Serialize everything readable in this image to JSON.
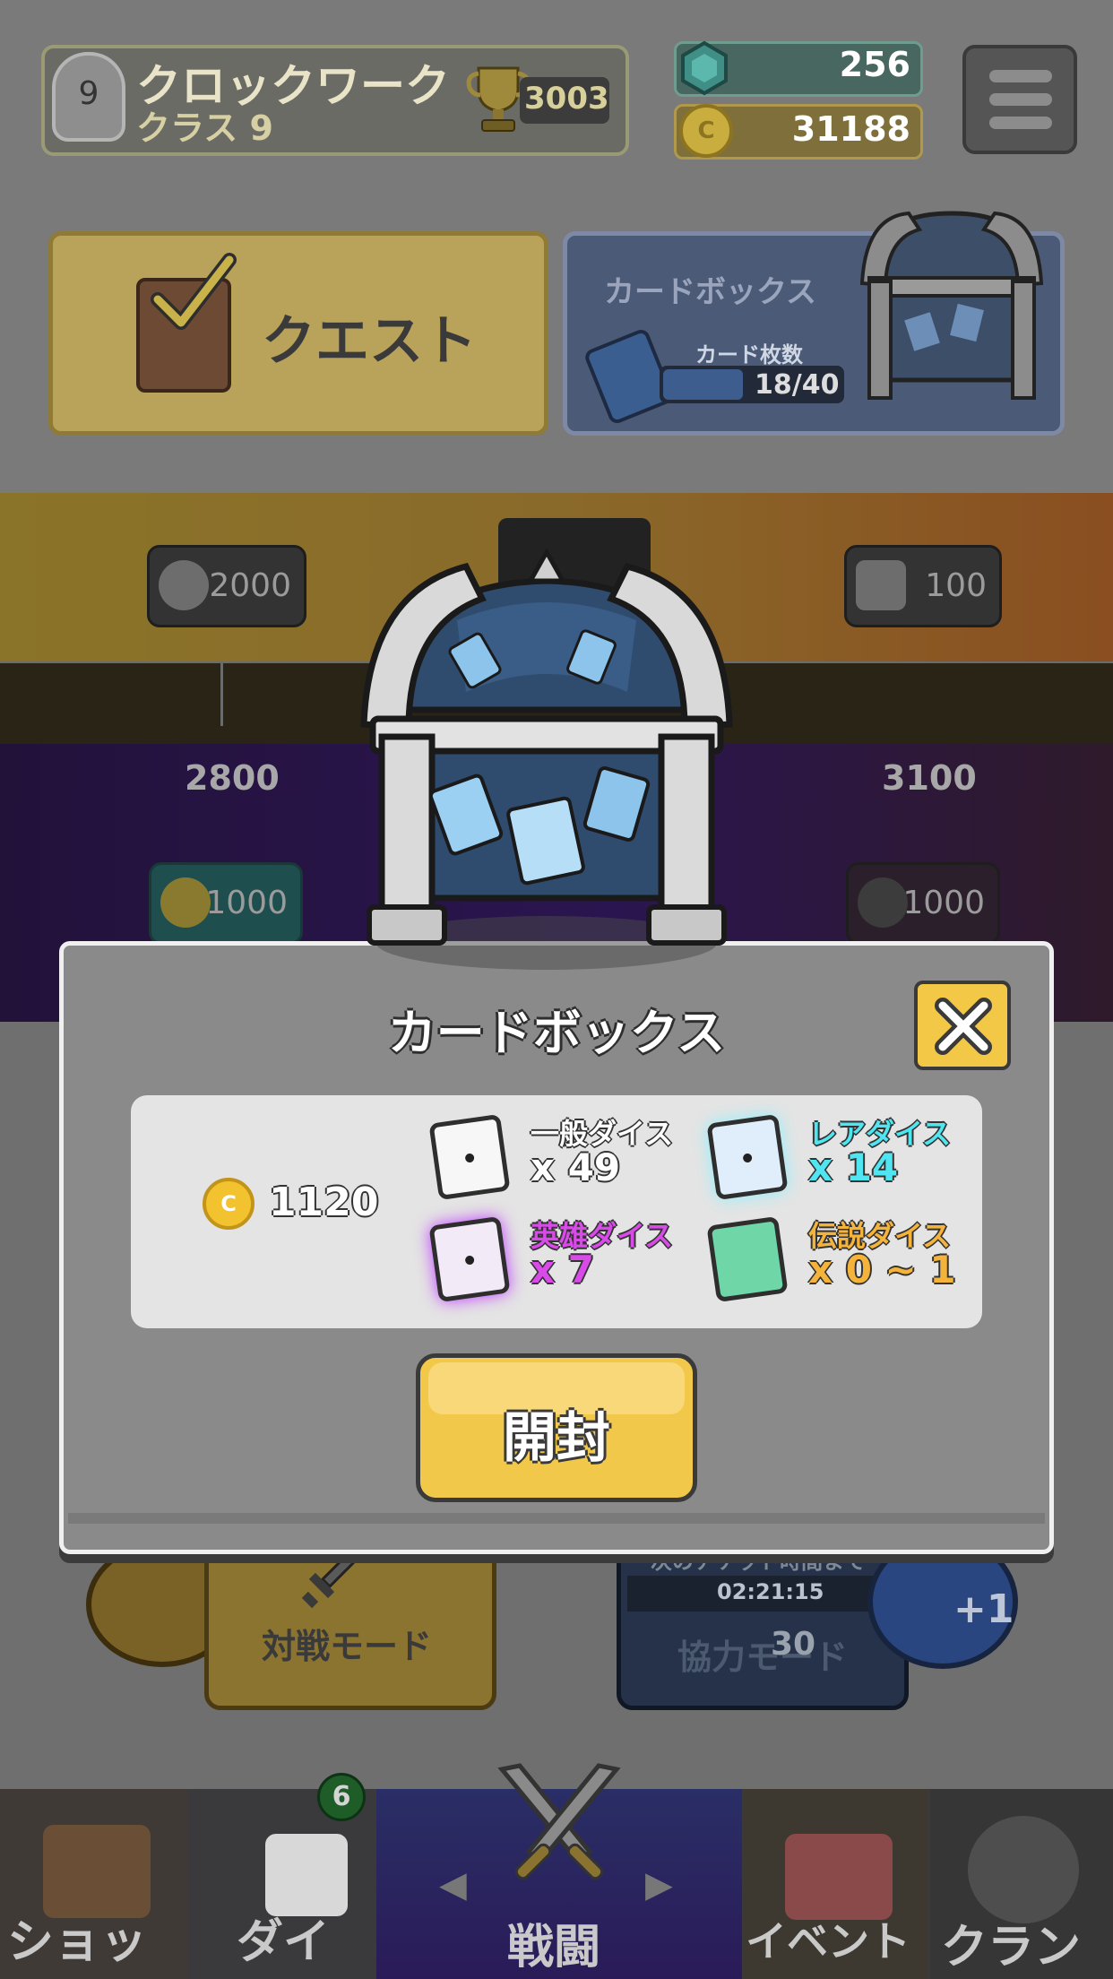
{
  "header": {
    "rank_number": "9",
    "player_name": "クロックワーク",
    "player_class": "クラス 9",
    "trophies": "3003",
    "gems": "256",
    "gold": "31188",
    "gold_icon_letter": "C"
  },
  "home": {
    "quest_label": "クエスト",
    "cardbox_title": "カードボックス",
    "cardbox_sub": "カード枚数",
    "cardbox_progress": "18/40",
    "cardbox_fill_fraction": 0.45
  },
  "road": {
    "reward_left_top": "2000",
    "reward_right_top": "100",
    "trophy_left": "2800",
    "trophy_right": "3100",
    "reward_left_bottom": "1000",
    "reward_right_bottom": "1000"
  },
  "modes": {
    "battle_label": "対戦モード",
    "coop_label": "協力モード",
    "coop_timer_note": "次のチケット時間まで",
    "coop_timer": "02:21:15",
    "coop_cost": "30",
    "coop_plus": "+1"
  },
  "modal": {
    "title": "カードボックス",
    "coin_icon_letter": "C",
    "coin_amount": "1120",
    "dice": [
      {
        "label": "一般ダイス",
        "count": "x 49"
      },
      {
        "label": "レアダイス",
        "count": "x 14"
      },
      {
        "label": "英雄ダイス",
        "count": "x 7"
      },
      {
        "label": "伝説ダイス",
        "count": "x 0 ~ 1"
      }
    ],
    "open_label": "開封"
  },
  "nav": {
    "shop": "ショップ",
    "dice": "ダイス",
    "dice_badge": "6",
    "battle": "戦闘",
    "event": "イベント",
    "clan": "クラン"
  },
  "colors": {
    "rare": "#4fe6f2",
    "hero": "#d94be8",
    "legend": "#f4b43c",
    "button_yellow": "#f2c84a"
  }
}
